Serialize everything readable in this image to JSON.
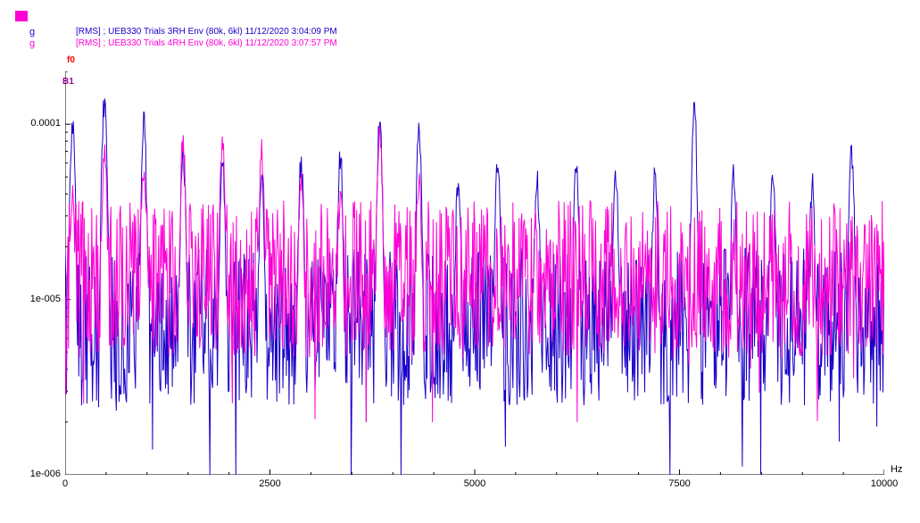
{
  "legend": {
    "series": [
      {
        "unit": "g",
        "label": "[RMS] ; UEB330 Trials 3RH Env (80k, 6kl) 11/12/2020 3:04:09 PM",
        "color": "#1800c8"
      },
      {
        "unit": "g",
        "label": "[RMS] ; UEB330 Trials 4RH Env (80k, 6kl) 11/12/2020 3:07:57 PM",
        "color": "#ff00d4"
      }
    ]
  },
  "markers": {
    "f0": {
      "text": "f0",
      "color": "#ff0000"
    },
    "B1": {
      "text": "B1",
      "color": "#a000a0"
    }
  },
  "axes": {
    "x": {
      "label": "Hz",
      "min": 0,
      "max": 10000,
      "ticks": [
        0,
        2500,
        5000,
        7500,
        10000
      ]
    },
    "y": {
      "min": 1e-06,
      "max": 0.0002,
      "ticks": [
        "1e-006",
        "1e-005",
        "0.0001"
      ],
      "tickValues": [
        1e-06,
        1e-05,
        0.0001
      ],
      "scale": "log"
    }
  },
  "chart_data": {
    "type": "line",
    "xlabel": "Hz",
    "ylabel": "g [RMS]",
    "yscale": "log",
    "xlim": [
      0,
      10000
    ],
    "ylim": [
      1e-06,
      0.0002
    ],
    "series": [
      {
        "name": "UEB330 Trials 3RH Env (80k, 6kl) 11/12/2020 3:04:09 PM",
        "color": "#1800c8",
        "type": "spectrum",
        "baseline": 7e-06,
        "noise_range": [
          2e-06,
          3e-05
        ],
        "peaks_hz": [
          90,
          480,
          960,
          1440,
          1920,
          2400,
          2880,
          3360,
          3840,
          4320,
          4800,
          5280,
          5760,
          6240,
          6720,
          7200,
          7680,
          8160,
          8640,
          9120,
          9600
        ],
        "peak_amplitude_approx": [
          0.0001,
          0.00014,
          0.0001,
          7e-05,
          6e-05,
          5e-05,
          6e-05,
          6.5e-05,
          0.0001,
          9e-05,
          5e-05,
          6e-05,
          5e-05,
          6e-05,
          5e-05,
          5e-05,
          0.00012,
          5e-05,
          5e-05,
          4.5e-05,
          7e-05
        ]
      },
      {
        "name": "UEB330 Trials 4RH Env (80k, 6kl) 11/12/2020 3:07:57 PM",
        "color": "#ff00d4",
        "type": "spectrum",
        "baseline": 1.3e-05,
        "noise_range": [
          4e-06,
          3e-05
        ],
        "peaks_hz": [
          90,
          480,
          960,
          1440,
          1920,
          2400,
          2880,
          3360,
          3840,
          4320
        ],
        "peak_amplitude_approx": [
          4e-05,
          7e-05,
          6e-05,
          8e-05,
          7.5e-05,
          7e-05,
          5e-05,
          4e-05,
          9e-05,
          5e-05
        ]
      }
    ]
  }
}
